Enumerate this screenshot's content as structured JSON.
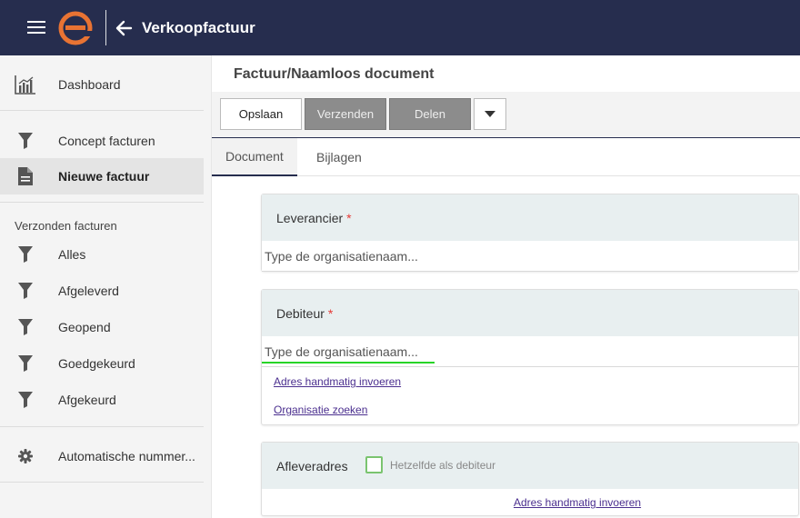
{
  "header": {
    "title": "Verkoopfactuur",
    "logo_letter": "e",
    "accent": "#e87333",
    "background": "#262d4e"
  },
  "sidebar": {
    "dashboard": "Dashboard",
    "concept": "Concept facturen",
    "new_invoice": "Nieuwe factuur",
    "sent_section": "Verzonden facturen",
    "filters": [
      "Alles",
      "Afgeleverd",
      "Geopend",
      "Goedgekeurd",
      "Afgekeurd"
    ],
    "auto_numbering": "Automatische nummer..."
  },
  "main": {
    "doc_title": "Factuur/Naamloos document",
    "toolbar": {
      "save": "Opslaan",
      "send": "Verzenden",
      "share": "Delen"
    },
    "tabs": [
      "Document",
      "Bijlagen"
    ],
    "supplier": {
      "label": "Leverancier",
      "required_mark": "*",
      "placeholder": "Type de organisatienaam..."
    },
    "debtor": {
      "label": "Debiteur",
      "required_mark": "*",
      "placeholder": "Type de organisatienaam...",
      "link_manual": "Adres handmatig invoeren",
      "link_search": "Organisatie zoeken"
    },
    "delivery": {
      "label": "Afleveradres",
      "checkbox_label": "Hetzelfde als debiteur",
      "link_manual": "Adres handmatig invoeren"
    }
  }
}
